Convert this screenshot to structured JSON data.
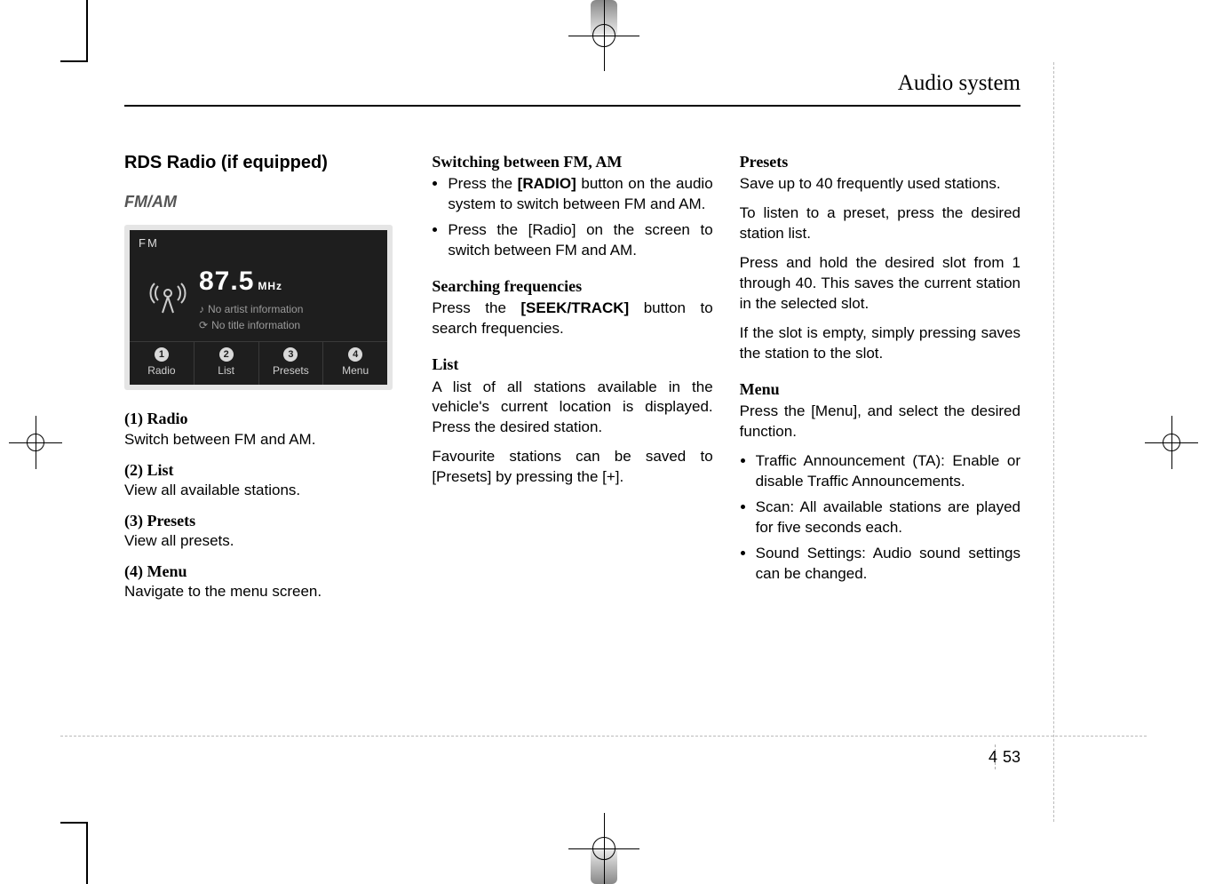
{
  "header": {
    "section_title": "Audio system"
  },
  "page": {
    "chapter": "4",
    "number": "53"
  },
  "col1": {
    "title": "RDS Radio (if equipped)",
    "subheading": "FM/AM",
    "shot": {
      "band": "FM",
      "freq_value": "87.5",
      "freq_unit": "MHz",
      "artist_line": "No artist information",
      "title_line": "No title information",
      "tabs": [
        {
          "badge": "1",
          "label": "Radio"
        },
        {
          "badge": "2",
          "label": "List"
        },
        {
          "badge": "3",
          "label": "Presets"
        },
        {
          "badge": "4",
          "label": "Menu"
        }
      ]
    },
    "items": [
      {
        "label": "(1) Radio",
        "desc": "Switch between FM and AM."
      },
      {
        "label": "(2) List",
        "desc": "View all available stations."
      },
      {
        "label": "(3) Presets",
        "desc": "View all presets."
      },
      {
        "label": "(4) Menu",
        "desc": "Navigate to the menu screen."
      }
    ]
  },
  "col2": {
    "h1": "Switching between FM, AM",
    "b1a": "Press the ",
    "b1b": "[RADIO]",
    "b1c": " button on the audio system to switch between FM and AM.",
    "b2": "Press the [Radio] on the screen to switch between FM and AM.",
    "h2": "Searching frequencies",
    "p2a": "Press the ",
    "p2b": "[SEEK/TRACK]",
    "p2c": " button to search frequencies.",
    "h3": "List",
    "p3": "A list of all stations available in the vehicle's current location is displayed. Press the desired station.",
    "p4": "Favourite stations can be saved to [Presets] by pressing the [+]."
  },
  "col3": {
    "h1": "Presets",
    "p1": "Save up to 40 frequently used stations.",
    "p2": "To listen to a preset, press the desired station list.",
    "p3": "Press and hold the desired slot from 1 through 40. This saves the current station in the selected slot.",
    "p4": "If the slot is empty, simply pressing saves the station to the slot.",
    "h2": "Menu",
    "p5": "Press the [Menu], and select the desired function.",
    "b1": "Traffic Announcement (TA): Enable or disable Traffic Announcements.",
    "b2": "Scan: All available stations are played for five seconds each.",
    "b3": "Sound Settings: Audio sound settings can be changed."
  }
}
